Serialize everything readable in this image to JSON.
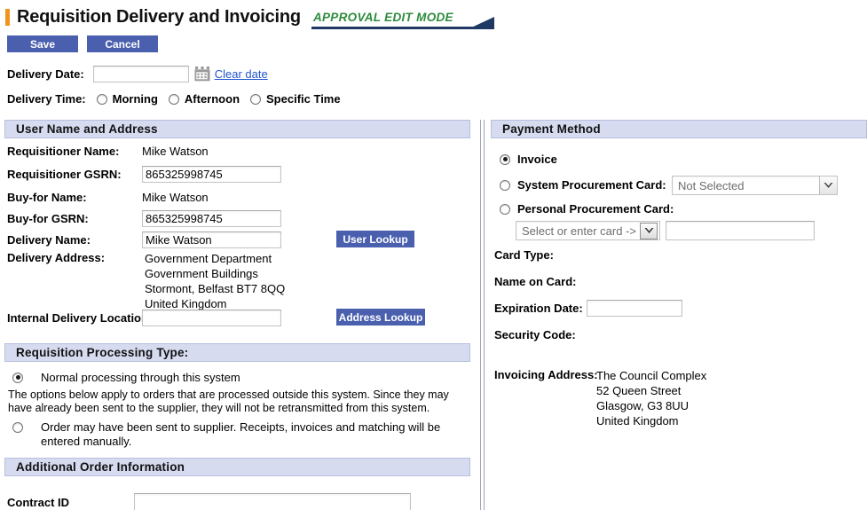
{
  "header": {
    "title": "Requisition Delivery and Invoicing",
    "mode_badge": "APPROVAL EDIT MODE",
    "accent_color": "#f0941e",
    "mode_color": "#2e8b3d",
    "rule_color": "#1f3864"
  },
  "toolbar": {
    "save_label": "Save",
    "cancel_label": "Cancel",
    "button_color": "#4a5fae"
  },
  "delivery": {
    "date_label": "Delivery Date:",
    "date_value": "",
    "date_placeholder": "",
    "calendar_icon": "calendar-icon",
    "clear_date_link": "Clear date",
    "time_label": "Delivery Time:",
    "time_options": [
      {
        "label": "Morning",
        "selected": false
      },
      {
        "label": "Afternoon",
        "selected": false
      },
      {
        "label": "Specific Time",
        "selected": false
      }
    ]
  },
  "user_address": {
    "section_title": "User Name and Address",
    "requisitioner_name_label": "Requisitioner Name:",
    "requisitioner_name_value": "Mike Watson",
    "requisitioner_gsrn_label": "Requisitioner GSRN:",
    "requisitioner_gsrn_value": "865325998745",
    "buyfor_name_label": "Buy-for Name:",
    "buyfor_name_value": "Mike Watson",
    "buyfor_gsrn_label": "Buy-for GSRN:",
    "buyfor_gsrn_value": "865325998745",
    "delivery_name_label": "Delivery Name:",
    "delivery_name_value": "Mike Watson",
    "user_lookup_label": "User Lookup",
    "delivery_address_label": "Delivery Address:",
    "delivery_address_lines": [
      "Government Department",
      "Government Buildings",
      "Stormont, Belfast BT7 8QQ",
      "United Kingdom"
    ],
    "internal_location_label": "Internal Delivery Location:",
    "internal_location_value": "",
    "address_lookup_label": "Address Lookup"
  },
  "processing_type": {
    "section_title": "Requisition Processing Type:",
    "option_normal": "Normal processing through this system",
    "option_normal_selected": true,
    "note": "The options below apply to orders that are processed outside this system. Since they may have already been sent to the supplier, they will not be retransmitted from this system.",
    "option_manual": "Order may have been sent to supplier. Receipts, invoices and matching will be entered manually.",
    "option_manual_selected": false
  },
  "additional_order": {
    "section_title": "Additional Order Information",
    "contract_id_label": "Contract ID",
    "contract_id_value": ""
  },
  "payment": {
    "section_title": "Payment Method",
    "invoice_label": "Invoice",
    "invoice_selected": true,
    "system_card_label": "System Procurement Card:",
    "system_card_selected": false,
    "system_card_select_value": "Not Selected",
    "personal_card_label": "Personal Procurement Card:",
    "personal_card_selected": false,
    "personal_card_select_value": "Select or enter card ->",
    "personal_card_text_value": "",
    "card_type_label": "Card Type:",
    "card_type_value": "",
    "name_on_card_label": "Name on Card:",
    "name_on_card_value": "",
    "expiration_label": "Expiration Date:",
    "expiration_value": "",
    "security_code_label": "Security Code:",
    "security_code_value": "",
    "invoicing_address_label": "Invoicing Address:",
    "invoicing_address_lines": [
      "The Council Complex",
      "52 Queen Street",
      "Glasgow, G3 8UU",
      "United Kingdom"
    ]
  }
}
